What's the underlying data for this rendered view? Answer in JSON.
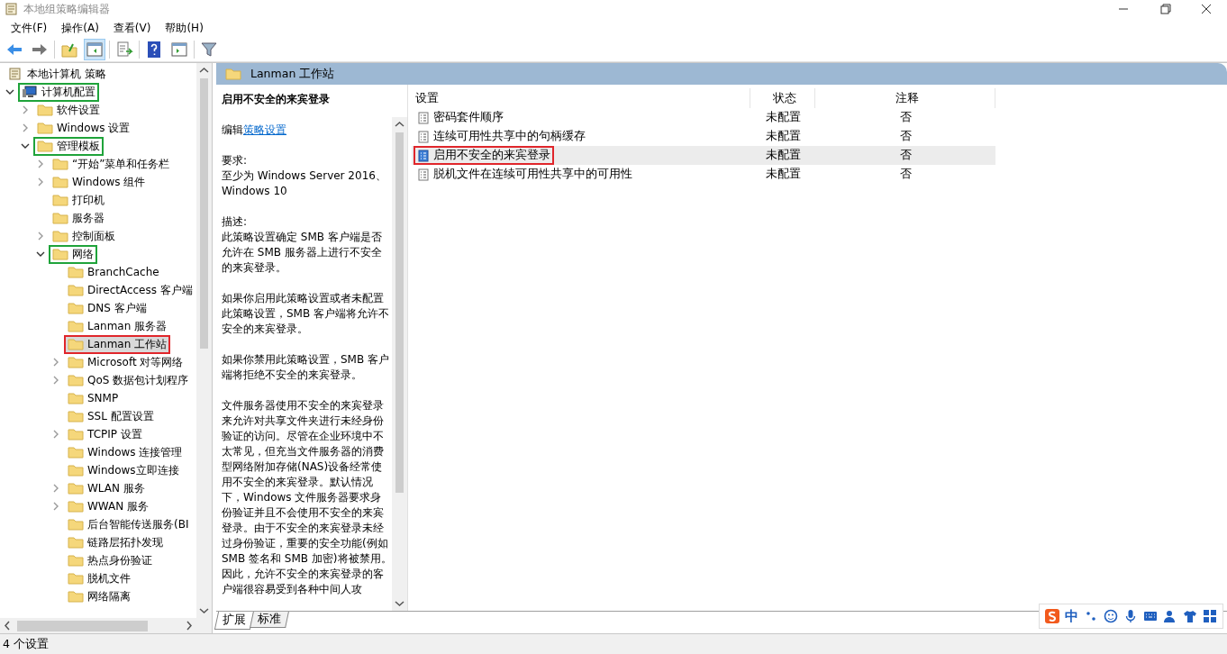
{
  "window": {
    "title": "本地组策略编辑器"
  },
  "menu": [
    "文件(F)",
    "操作(A)",
    "查看(V)",
    "帮助(H)"
  ],
  "tree": {
    "label": "本地计算机 策略",
    "children": [
      {
        "label": "计算机配置",
        "expanded": true,
        "color": "#1fa33a",
        "kind": "computer",
        "children": [
          {
            "label": "软件设置",
            "expanded": false
          },
          {
            "label": "Windows 设置",
            "expanded": false
          },
          {
            "label": "管理模板",
            "expanded": true,
            "color": "#1fa33a",
            "children": [
              {
                "label": "“开始”菜单和任务栏",
                "expanded": false
              },
              {
                "label": "Windows 组件",
                "expanded": false
              },
              {
                "label": "打印机"
              },
              {
                "label": "服务器"
              },
              {
                "label": "控制面板",
                "expanded": false
              },
              {
                "label": "网络",
                "expanded": true,
                "color": "#1fa33a",
                "children": [
                  {
                    "label": "BranchCache"
                  },
                  {
                    "label": "DirectAccess 客户端"
                  },
                  {
                    "label": "DNS 客户端"
                  },
                  {
                    "label": "Lanman 服务器"
                  },
                  {
                    "label": "Lanman 工作站",
                    "selected": true,
                    "color": "#e0262b"
                  },
                  {
                    "label": "Microsoft 对等网络",
                    "expanded": false
                  },
                  {
                    "label": "QoS 数据包计划程序",
                    "expanded": false
                  },
                  {
                    "label": "SNMP"
                  },
                  {
                    "label": "SSL 配置设置"
                  },
                  {
                    "label": "TCPIP 设置",
                    "expanded": false
                  },
                  {
                    "label": "Windows 连接管理"
                  },
                  {
                    "label": "Windows立即连接"
                  },
                  {
                    "label": "WLAN 服务",
                    "expanded": false
                  },
                  {
                    "label": "WWAN 服务",
                    "expanded": false
                  },
                  {
                    "label": "后台智能传送服务(BI"
                  },
                  {
                    "label": "链路层拓扑发现"
                  },
                  {
                    "label": "热点身份验证"
                  },
                  {
                    "label": "脱机文件"
                  },
                  {
                    "label": "网络隔离"
                  }
                ]
              }
            ]
          }
        ]
      }
    ]
  },
  "pane_header": "Lanman 工作站",
  "description": {
    "title": "启用不安全的来宾登录",
    "edit_prefix": "编辑",
    "edit_link": "策略设置",
    "sections": [
      {
        "heading": "要求:",
        "paragraphs": [
          "至少为 Windows Server 2016、Windows 10"
        ]
      },
      {
        "heading": "描述:",
        "paragraphs": [
          "此策略设置确定 SMB 客户端是否允许在 SMB 服务器上进行不安全的来宾登录。",
          "如果你启用此策略设置或者未配置此策略设置，SMB 客户端将允许不安全的来宾登录。",
          "如果你禁用此策略设置，SMB 客户端将拒绝不安全的来宾登录。",
          "文件服务器使用不安全的来宾登录来允许对共享文件夹进行未经身份验证的访问。尽管在企业环境中不太常见，但充当文件服务器的消费型网络附加存储(NAS)设备经常使用不安全的来宾登录。默认情况下，Windows 文件服务器要求身份验证并且不会使用不安全的来宾登录。由于不安全的来宾登录未经过身份验证，重要的安全功能(例如 SMB 签名和 SMB 加密)将被禁用。因此，允许不安全的来宾登录的客户端很容易受到各种中间人攻"
        ]
      }
    ]
  },
  "table": {
    "columns": [
      "设置",
      "状态",
      "注释"
    ],
    "rows": [
      {
        "name": "密码套件顺序",
        "state": "未配置",
        "note": "否",
        "selected": false
      },
      {
        "name": "连续可用性共享中的句柄缓存",
        "state": "未配置",
        "note": "否",
        "selected": false
      },
      {
        "name": "启用不安全的来宾登录",
        "state": "未配置",
        "note": "否",
        "selected": true,
        "color": "#e0262b"
      },
      {
        "name": "脱机文件在连续可用性共享中的可用性",
        "state": "未配置",
        "note": "否",
        "selected": false
      }
    ]
  },
  "view_tabs": [
    {
      "label": "扩展",
      "selected": true
    },
    {
      "label": "标准",
      "selected": false
    }
  ],
  "status_bar": "4 个设置",
  "ime_toolbar": {
    "mode": "中"
  }
}
